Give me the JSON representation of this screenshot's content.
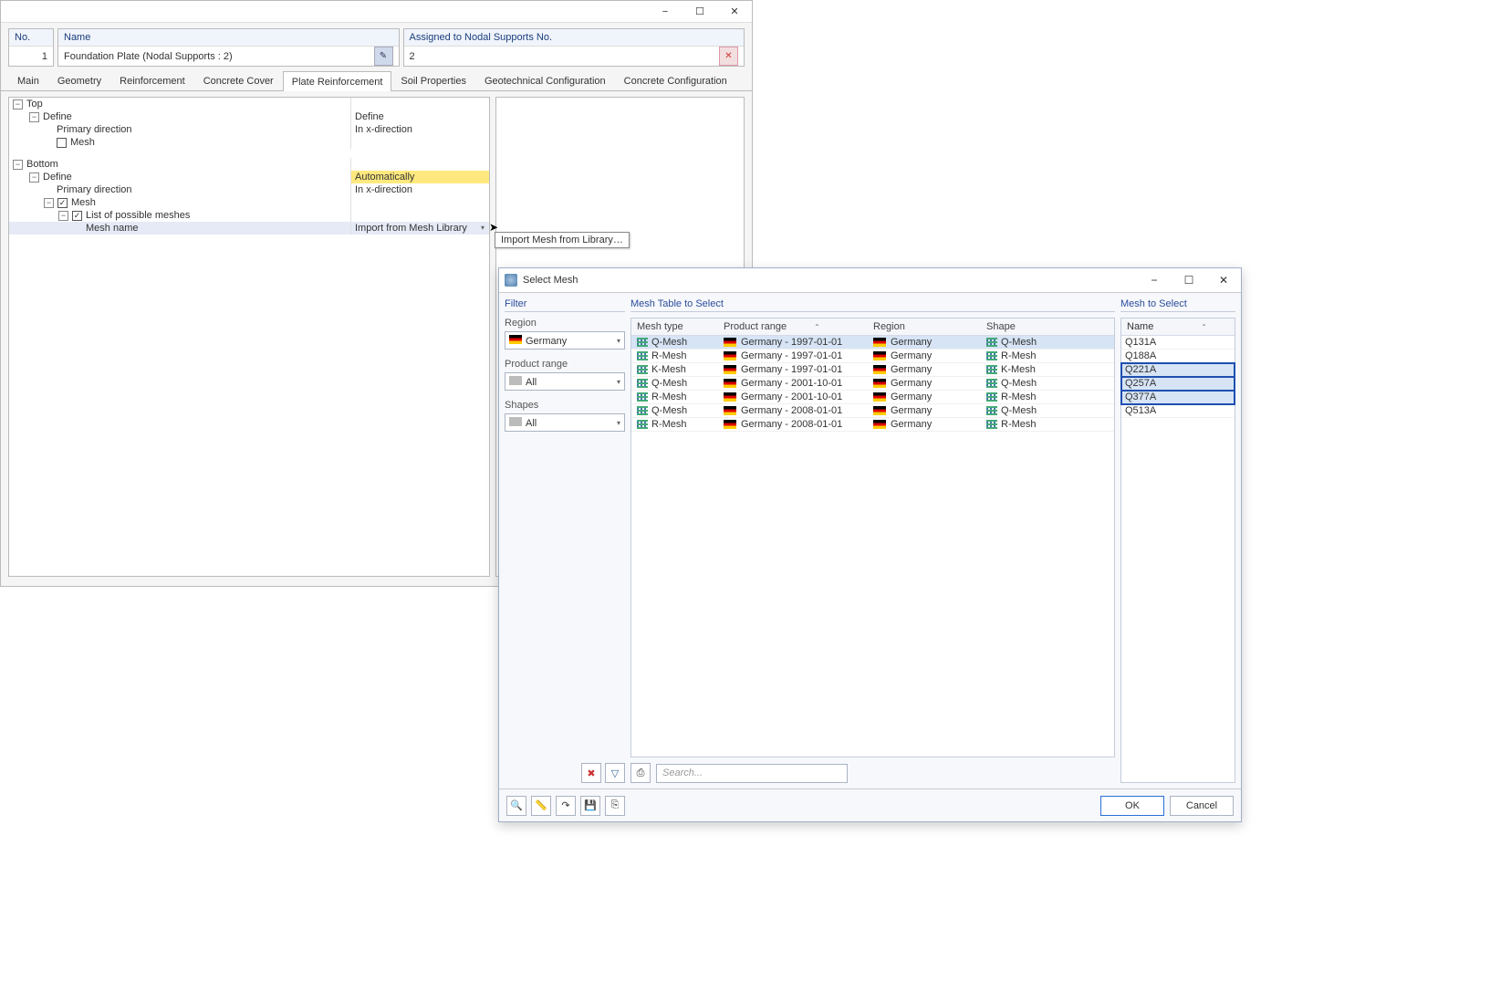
{
  "parent": {
    "title_min": "−",
    "title_max": "☐",
    "title_close": "✕",
    "no_label": "No.",
    "no_value": "1",
    "name_label": "Name",
    "name_value": "Foundation Plate (Nodal Supports : 2)",
    "assigned_label": "Assigned to Nodal Supports No.",
    "assigned_value": "2",
    "tabs": [
      "Main",
      "Geometry",
      "Reinforcement",
      "Concrete Cover",
      "Plate Reinforcement",
      "Soil Properties",
      "Geotechnical Configuration",
      "Concrete Configuration"
    ],
    "active_tab_index": 4,
    "tree": {
      "top": "Top",
      "define_top": "Define",
      "primary_dir": "Primary direction",
      "in_x": "In x-direction",
      "mesh_unchecked": "Mesh",
      "bottom": "Bottom",
      "define_bottom": "Define",
      "define_bottom_val": "Automatically",
      "primary_dir2": "Primary direction",
      "in_x2": "In x-direction",
      "mesh_checked": "Mesh",
      "list_possible": "List of possible meshes",
      "mesh_name": "Mesh name",
      "mesh_name_val": "Import from Mesh Library"
    },
    "tooltip": "Import Mesh from Library…"
  },
  "dialog": {
    "title": "Select Mesh",
    "filter": {
      "title": "Filter",
      "region_label": "Region",
      "region_value": "Germany",
      "product_label": "Product range",
      "product_value": "All",
      "shapes_label": "Shapes",
      "shapes_value": "All"
    },
    "mesh_table": {
      "title": "Mesh Table to Select",
      "cols": {
        "type": "Mesh type",
        "range": "Product range",
        "region": "Region",
        "shape": "Shape"
      },
      "rows": [
        {
          "type": "Q-Mesh",
          "range": "Germany - 1997-01-01",
          "region": "Germany",
          "shape": "Q-Mesh",
          "selected": true
        },
        {
          "type": "R-Mesh",
          "range": "Germany - 1997-01-01",
          "region": "Germany",
          "shape": "R-Mesh",
          "selected": false
        },
        {
          "type": "K-Mesh",
          "range": "Germany - 1997-01-01",
          "region": "Germany",
          "shape": "K-Mesh",
          "selected": false
        },
        {
          "type": "Q-Mesh",
          "range": "Germany - 2001-10-01",
          "region": "Germany",
          "shape": "Q-Mesh",
          "selected": false
        },
        {
          "type": "R-Mesh",
          "range": "Germany - 2001-10-01",
          "region": "Germany",
          "shape": "R-Mesh",
          "selected": false
        },
        {
          "type": "Q-Mesh",
          "range": "Germany - 2008-01-01",
          "region": "Germany",
          "shape": "Q-Mesh",
          "selected": false
        },
        {
          "type": "R-Mesh",
          "range": "Germany - 2008-01-01",
          "region": "Germany",
          "shape": "R-Mesh",
          "selected": false
        }
      ],
      "search_placeholder": "Search..."
    },
    "mesh_select": {
      "title": "Mesh to Select",
      "col_name": "Name",
      "rows": [
        {
          "name": "Q131A",
          "selected": false
        },
        {
          "name": "Q188A",
          "selected": false
        },
        {
          "name": "Q221A",
          "selected": true
        },
        {
          "name": "Q257A",
          "selected": true
        },
        {
          "name": "Q377A",
          "selected": true
        },
        {
          "name": "Q513A",
          "selected": false
        }
      ]
    },
    "ok_label": "OK",
    "cancel_label": "Cancel"
  }
}
